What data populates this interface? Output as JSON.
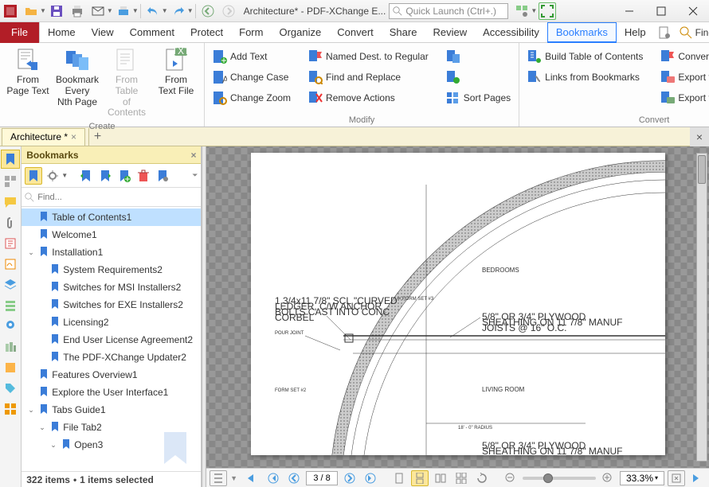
{
  "title": "Architecture* - PDF-XChange E...",
  "quick_launch_placeholder": "Quick Launch (Ctrl+.)",
  "menus": [
    "Home",
    "View",
    "Comment",
    "Protect",
    "Form",
    "Organize",
    "Convert",
    "Share",
    "Review",
    "Accessibility",
    "Bookmarks",
    "Help"
  ],
  "active_menu": "Bookmarks",
  "file_label": "File",
  "find_label": "Find...",
  "ribbon": {
    "create": {
      "title": "Create",
      "from_page_text": "From\nPage Text",
      "bookmark_every": "Bookmark Every\nNth Page",
      "from_toc": "From Table\nof Contents",
      "from_text_file": "From\nText File"
    },
    "modify": {
      "title": "Modify",
      "add_text": "Add Text",
      "change_case": "Change Case",
      "change_zoom": "Change Zoom",
      "named_dest": "Named Dest. to Regular",
      "find_replace": "Find and Replace",
      "remove_actions": "Remove Actions",
      "sort_pages": "Sort Pages"
    },
    "convert": {
      "title": "Convert",
      "build_toc": "Build Table of Contents",
      "links_bm": "Links from Bookmarks",
      "convert_named": "Convert to Named Dest.",
      "export_html": "Export to HTML",
      "export_text": "Export to Text File"
    }
  },
  "doctab": "Architecture *",
  "bookmarks": {
    "title": "Bookmarks",
    "find_placeholder": "Find...",
    "items": [
      {
        "label": "Table of Contents1",
        "lvl": 0,
        "sel": true,
        "exp": null
      },
      {
        "label": "Welcome1",
        "lvl": 0,
        "exp": null
      },
      {
        "label": "Installation1",
        "lvl": 0,
        "exp": "open"
      },
      {
        "label": "System Requirements2",
        "lvl": 1
      },
      {
        "label": "Switches for MSI Installers2",
        "lvl": 1
      },
      {
        "label": "Switches for EXE Installers2",
        "lvl": 1
      },
      {
        "label": "Licensing2",
        "lvl": 1
      },
      {
        "label": "End User License Agreement2",
        "lvl": 1
      },
      {
        "label": "The PDF-XChange Updater2",
        "lvl": 1
      },
      {
        "label": "Features Overview1",
        "lvl": 0,
        "exp": null
      },
      {
        "label": "Explore the User Interface1",
        "lvl": 0,
        "exp": null
      },
      {
        "label": "Tabs Guide1",
        "lvl": 0,
        "exp": "open"
      },
      {
        "label": "File Tab2",
        "lvl": 1,
        "exp": "open"
      },
      {
        "label": "Open3",
        "lvl": 2,
        "exp": "open"
      }
    ],
    "status_items": "322 items",
    "status_sel": "1 items selected"
  },
  "drawing": {
    "bedrooms": "BEDROOMS",
    "living": "LIVING ROOM",
    "radius": "18' - 0\"    RADIUS",
    "form_set2": "FORM SET #2",
    "form_set3": "FORM SET #3",
    "pour": "POUR JOINT",
    "ledger": "1 3/4x11 7/8\" SCL \"CURVED\"\nLEDGER, C/W ANCHOR\nBOLTS CAST INTO CONC\nCORBEL",
    "plywood": "5/8\" OR 3/4\" PLYWOOD\nSHEATHING ON 11 7/8\" MANUF\nJOISTS @ 16\" O.C."
  },
  "status": {
    "page": "3 / 8",
    "zoom": "33.3%"
  }
}
